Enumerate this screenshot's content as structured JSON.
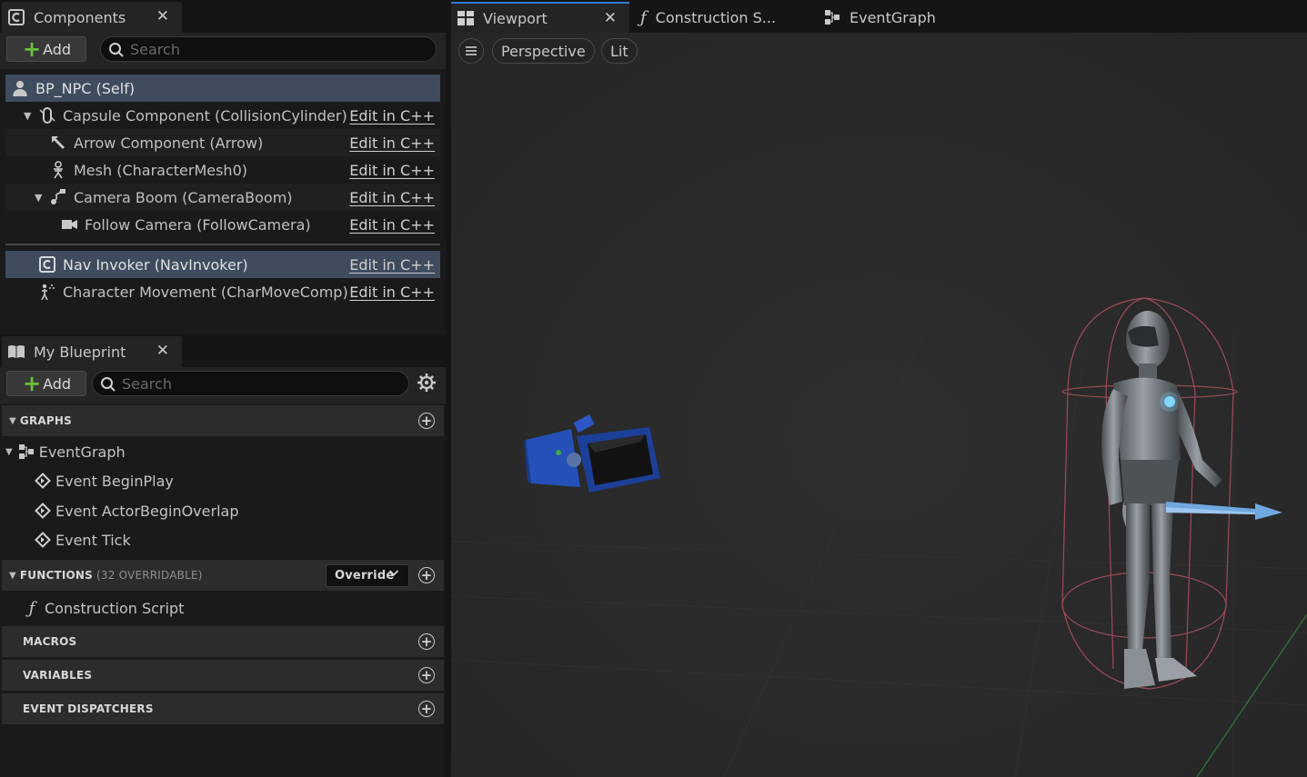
{
  "components_panel": {
    "tab_title": "Components",
    "add_label": "Add",
    "search_placeholder": "Search",
    "self_item": "BP_NPC (Self)",
    "items": [
      {
        "label": "Capsule Component (CollisionCylinder)",
        "edit": "Edit in C++"
      },
      {
        "label": "Arrow Component (Arrow)",
        "edit": "Edit in C++"
      },
      {
        "label": "Mesh (CharacterMesh0)",
        "edit": "Edit in C++"
      },
      {
        "label": "Camera Boom (CameraBoom)",
        "edit": "Edit in C++"
      },
      {
        "label": "Follow Camera (FollowCamera)",
        "edit": "Edit in C++"
      },
      {
        "label": "Nav Invoker (NavInvoker)",
        "edit": "Edit in C++"
      },
      {
        "label": "Character Movement (CharMoveComp)",
        "edit": "Edit in C++"
      }
    ]
  },
  "blueprint_panel": {
    "tab_title": "My Blueprint",
    "add_label": "Add",
    "search_placeholder": "Search",
    "graphs_label": "GRAPHS",
    "event_graph": "EventGraph",
    "events": [
      "Event BeginPlay",
      "Event ActorBeginOverlap",
      "Event Tick"
    ],
    "functions_label": "FUNCTIONS",
    "functions_sub": "(32 OVERRIDABLE)",
    "override_label": "Override",
    "construction_script": "Construction Script",
    "macros_label": "MACROS",
    "variables_label": "VARIABLES",
    "dispatchers_label": "EVENT DISPATCHERS"
  },
  "editor_tabs": {
    "viewport": "Viewport",
    "construction": "Construction S...",
    "event_graph": "EventGraph"
  },
  "viewport": {
    "perspective_label": "Perspective",
    "lit_label": "Lit"
  },
  "colors": {
    "accent": "#2c7ad6",
    "selection": "#3e4c5e",
    "add_plus": "#6bbf3a",
    "camera_blue": "#2450b8",
    "capsule_wire": "#b05060",
    "arrow_blue": "#6fa8e0"
  }
}
